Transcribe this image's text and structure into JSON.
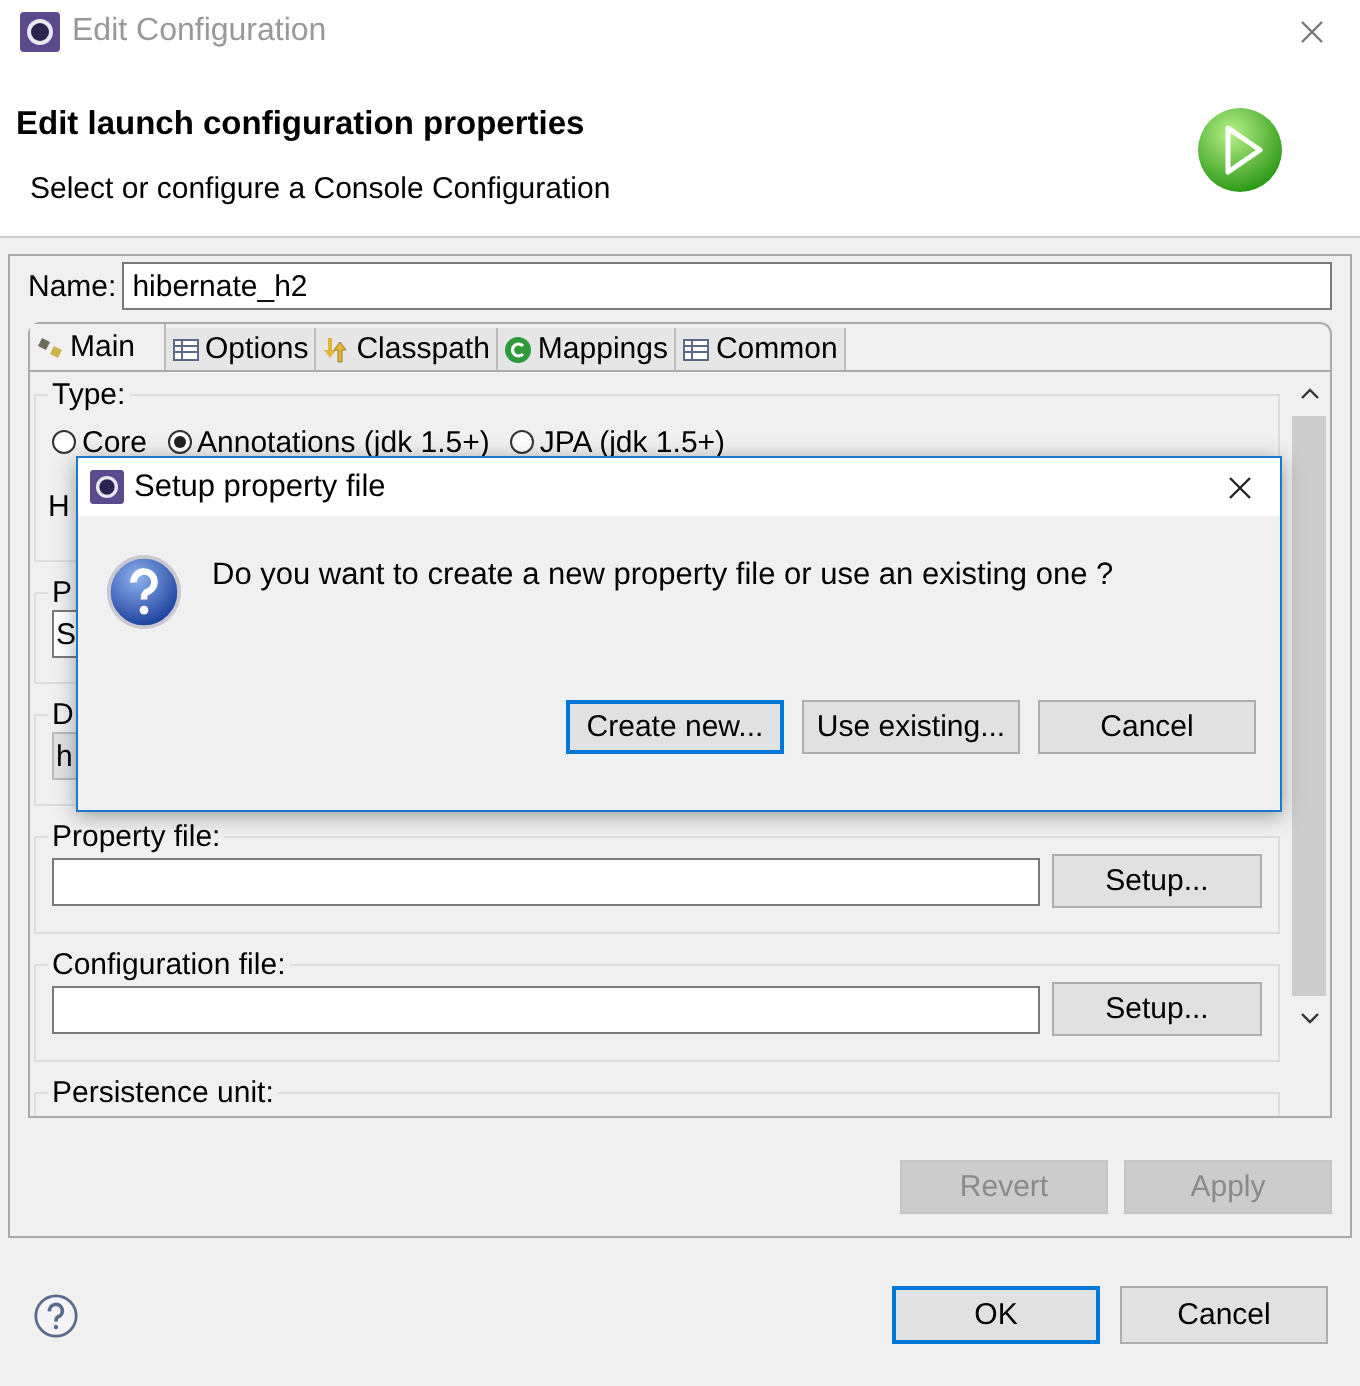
{
  "window": {
    "title": "Edit Configuration"
  },
  "header": {
    "title": "Edit launch configuration properties",
    "subtitle": "Select or configure a Console Configuration"
  },
  "name_field": {
    "label": "Name:",
    "value": "hibernate_h2"
  },
  "tabs": [
    {
      "label": "Main",
      "selected": true,
      "kind": "main"
    },
    {
      "label": "Options",
      "selected": false,
      "kind": "table"
    },
    {
      "label": "Classpath",
      "selected": false,
      "kind": "classpath"
    },
    {
      "label": "Mappings",
      "selected": false,
      "kind": "mapping"
    },
    {
      "label": "Common",
      "selected": false,
      "kind": "table"
    }
  ],
  "main_tab": {
    "type_group": {
      "label": "Type:",
      "radios": [
        {
          "label": "Core",
          "selected": false
        },
        {
          "label": "Annotations (jdk 1.5+)",
          "selected": true
        },
        {
          "label": "JPA (jdk 1.5+)",
          "selected": false
        }
      ],
      "next_line": "H"
    },
    "group_2": {
      "label": "P",
      "field_value": "S"
    },
    "group_3": {
      "label": "D",
      "field_value": "h"
    },
    "property_file": {
      "label": "Property file:",
      "button": "Setup..."
    },
    "configuration_file": {
      "label": "Configuration file:",
      "button": "Setup..."
    },
    "persistence_unit": {
      "label": "Persistence unit:"
    }
  },
  "panel_buttons": [
    {
      "label": "Revert",
      "disabled": true
    },
    {
      "label": "Apply",
      "disabled": true
    }
  ],
  "footer_buttons": [
    {
      "label": "OK",
      "default": true
    },
    {
      "label": "Cancel",
      "default": false
    }
  ],
  "dialog": {
    "title": "Setup property file",
    "message": "Do you want to create a new property file or use an existing one ?",
    "buttons": [
      {
        "label": "Create new...",
        "default": true
      },
      {
        "label": "Use existing...",
        "default": false
      },
      {
        "label": "Cancel",
        "default": false
      }
    ]
  }
}
